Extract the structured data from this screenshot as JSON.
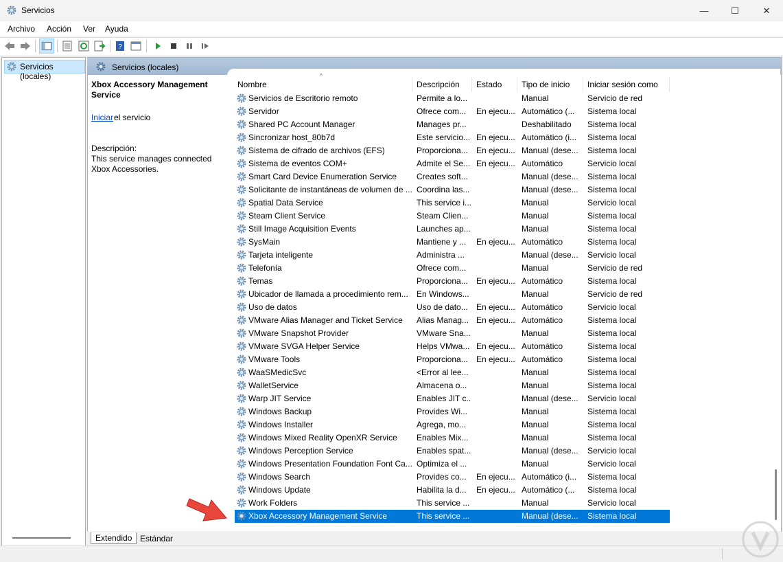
{
  "window": {
    "title": "Servicios",
    "controls": {
      "minimize": "—",
      "maximize": "☐",
      "close": "✕"
    }
  },
  "menu": [
    "Archivo",
    "Acción",
    "Ver",
    "Ayuda"
  ],
  "tree": {
    "item": "Servicios (locales)"
  },
  "panel": {
    "title": "Servicios (locales)",
    "selected_name": "Xbox Accessory Management Service",
    "start_link": "Iniciar",
    "start_rest": " el servicio",
    "description_label": "Descripción:",
    "description_text": "This service manages connected Xbox Accessories."
  },
  "table": {
    "columns": [
      "Nombre",
      "Descripción",
      "Estado",
      "Tipo de inicio",
      "Iniciar sesión como"
    ],
    "rows": [
      [
        "Servicios de Escritorio remoto",
        "Permite a lo...",
        "",
        "Manual",
        "Servicio de red"
      ],
      [
        "Servidor",
        "Ofrece com...",
        "En ejecu...",
        "Automático (...",
        "Sistema local"
      ],
      [
        "Shared PC Account Manager",
        "Manages pr...",
        "",
        "Deshabilitado",
        "Sistema local"
      ],
      [
        "Sincronizar host_80b7d",
        "Este servicio...",
        "En ejecu...",
        "Automático (i...",
        "Sistema local"
      ],
      [
        "Sistema de cifrado de archivos (EFS)",
        "Proporciona...",
        "En ejecu...",
        "Manual (dese...",
        "Sistema local"
      ],
      [
        "Sistema de eventos COM+",
        "Admite el Se...",
        "En ejecu...",
        "Automático",
        "Servicio local"
      ],
      [
        "Smart Card Device Enumeration Service",
        "Creates soft...",
        "",
        "Manual (dese...",
        "Sistema local"
      ],
      [
        "Solicitante de instantáneas de volumen de ...",
        "Coordina las...",
        "",
        "Manual (dese...",
        "Sistema local"
      ],
      [
        "Spatial Data Service",
        "This service i...",
        "",
        "Manual",
        "Servicio local"
      ],
      [
        "Steam Client Service",
        "Steam Clien...",
        "",
        "Manual",
        "Sistema local"
      ],
      [
        "Still Image Acquisition Events",
        "Launches ap...",
        "",
        "Manual",
        "Sistema local"
      ],
      [
        "SysMain",
        "Mantiene y ...",
        "En ejecu...",
        "Automático",
        "Sistema local"
      ],
      [
        "Tarjeta inteligente",
        "Administra ...",
        "",
        "Manual (dese...",
        "Servicio local"
      ],
      [
        "Telefonía",
        "Ofrece com...",
        "",
        "Manual",
        "Servicio de red"
      ],
      [
        "Temas",
        "Proporciona...",
        "En ejecu...",
        "Automático",
        "Sistema local"
      ],
      [
        "Ubicador de llamada a procedimiento rem...",
        "En Windows...",
        "",
        "Manual",
        "Servicio de red"
      ],
      [
        "Uso de datos",
        "Uso de dato...",
        "En ejecu...",
        "Automático",
        "Servicio local"
      ],
      [
        "VMware Alias Manager and Ticket Service",
        "Alias Manag...",
        "En ejecu...",
        "Automático",
        "Sistema local"
      ],
      [
        "VMware Snapshot Provider",
        "VMware Sna...",
        "",
        "Manual",
        "Sistema local"
      ],
      [
        "VMware SVGA Helper Service",
        "Helps VMwa...",
        "En ejecu...",
        "Automático",
        "Sistema local"
      ],
      [
        "VMware Tools",
        "Proporciona...",
        "En ejecu...",
        "Automático",
        "Sistema local"
      ],
      [
        "WaaSMedicSvc",
        "<Error al lee...",
        "",
        "Manual",
        "Sistema local"
      ],
      [
        "WalletService",
        "Almacena o...",
        "",
        "Manual",
        "Sistema local"
      ],
      [
        "Warp JIT Service",
        "Enables JIT c...",
        "",
        "Manual (dese...",
        "Servicio local"
      ],
      [
        "Windows Backup",
        "Provides Wi...",
        "",
        "Manual",
        "Sistema local"
      ],
      [
        "Windows Installer",
        "Agrega, mo...",
        "",
        "Manual",
        "Sistema local"
      ],
      [
        "Windows Mixed Reality OpenXR Service",
        "Enables Mix...",
        "",
        "Manual",
        "Sistema local"
      ],
      [
        "Windows Perception Service",
        "Enables spat...",
        "",
        "Manual (dese...",
        "Servicio local"
      ],
      [
        "Windows Presentation Foundation Font Ca...",
        "Optimiza el ...",
        "",
        "Manual",
        "Servicio local"
      ],
      [
        "Windows Search",
        "Provides co...",
        "En ejecu...",
        "Automático (i...",
        "Sistema local"
      ],
      [
        "Windows Update",
        "Habilita la d...",
        "En ejecu...",
        "Automático (...",
        "Sistema local"
      ],
      [
        "Work Folders",
        "This service ...",
        "",
        "Manual",
        "Servicio local"
      ],
      [
        "Xbox Accessory Management Service",
        "This service ...",
        "",
        "Manual (dese...",
        "Sistema local"
      ]
    ],
    "selected_row": 32
  },
  "tabs": [
    "Extendido",
    "Estándar"
  ],
  "colors": {
    "selection": "#0078d7",
    "panel_header": "#a9bfd8",
    "arrow": "#e8453c"
  }
}
